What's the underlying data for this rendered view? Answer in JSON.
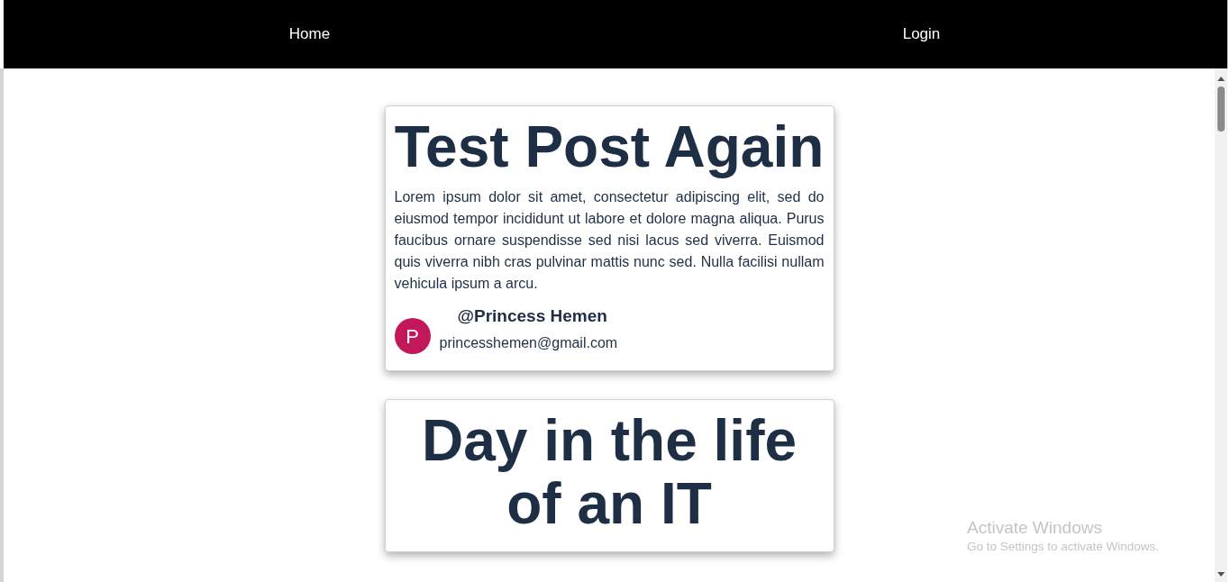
{
  "nav": {
    "links": [
      {
        "label": "Home"
      },
      {
        "label": "Login"
      }
    ]
  },
  "posts": [
    {
      "title": "Test Post Again",
      "body": "Lorem ipsum dolor sit amet, consectetur adipiscing elit, sed do eiusmod tempor incididunt ut labore et dolore magna aliqua. Purus faucibus ornare suspendisse sed nisi lacus sed viverra. Euismod quis viverra nibh cras pulvinar mattis nunc sed. Nulla facilisi nullam vehicula ipsum a arcu.",
      "author": {
        "initial": "P",
        "name": "@Princess Hemen",
        "email": "princesshemen@gmail.com"
      }
    },
    {
      "title": "Day in the life of an IT"
    }
  ],
  "os_notice": {
    "title": "Activate Windows",
    "subtitle": "Go to Settings to activate Windows."
  }
}
